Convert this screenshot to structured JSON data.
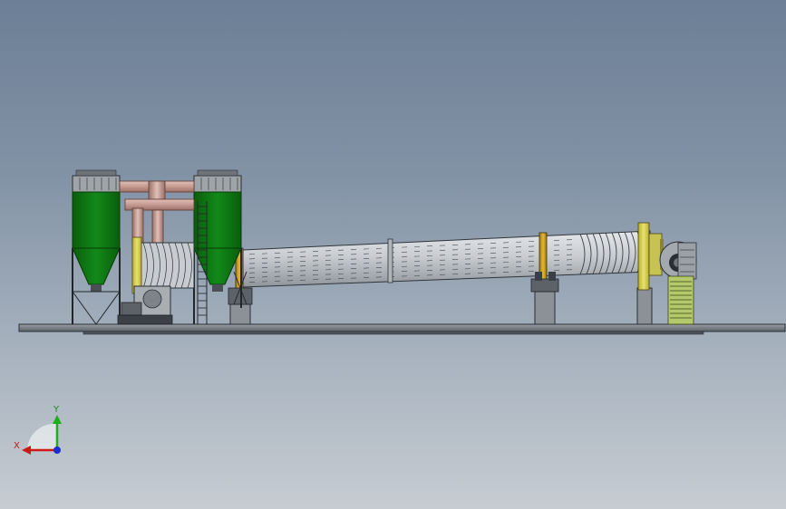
{
  "view": {
    "background_top": "#6c7f96",
    "background_bottom": "#c6ccd2"
  },
  "colors": {
    "dust_collector_body": "#0f7a10",
    "dust_collector_top": "#9aa0a4",
    "pipe": "#c9a29a",
    "drum": "#c8ccd0",
    "drum_line": "#3a4048",
    "riding_ring": "#c8a020",
    "base_frame": "#6e757c",
    "pedestal": "#8a8f94",
    "blower_green": "#a8c46a",
    "axis_x": "#d01818",
    "axis_y": "#19b019",
    "axis_z": "#1830d0"
  },
  "triad": {
    "x_label": "X",
    "y_label": "Y"
  }
}
